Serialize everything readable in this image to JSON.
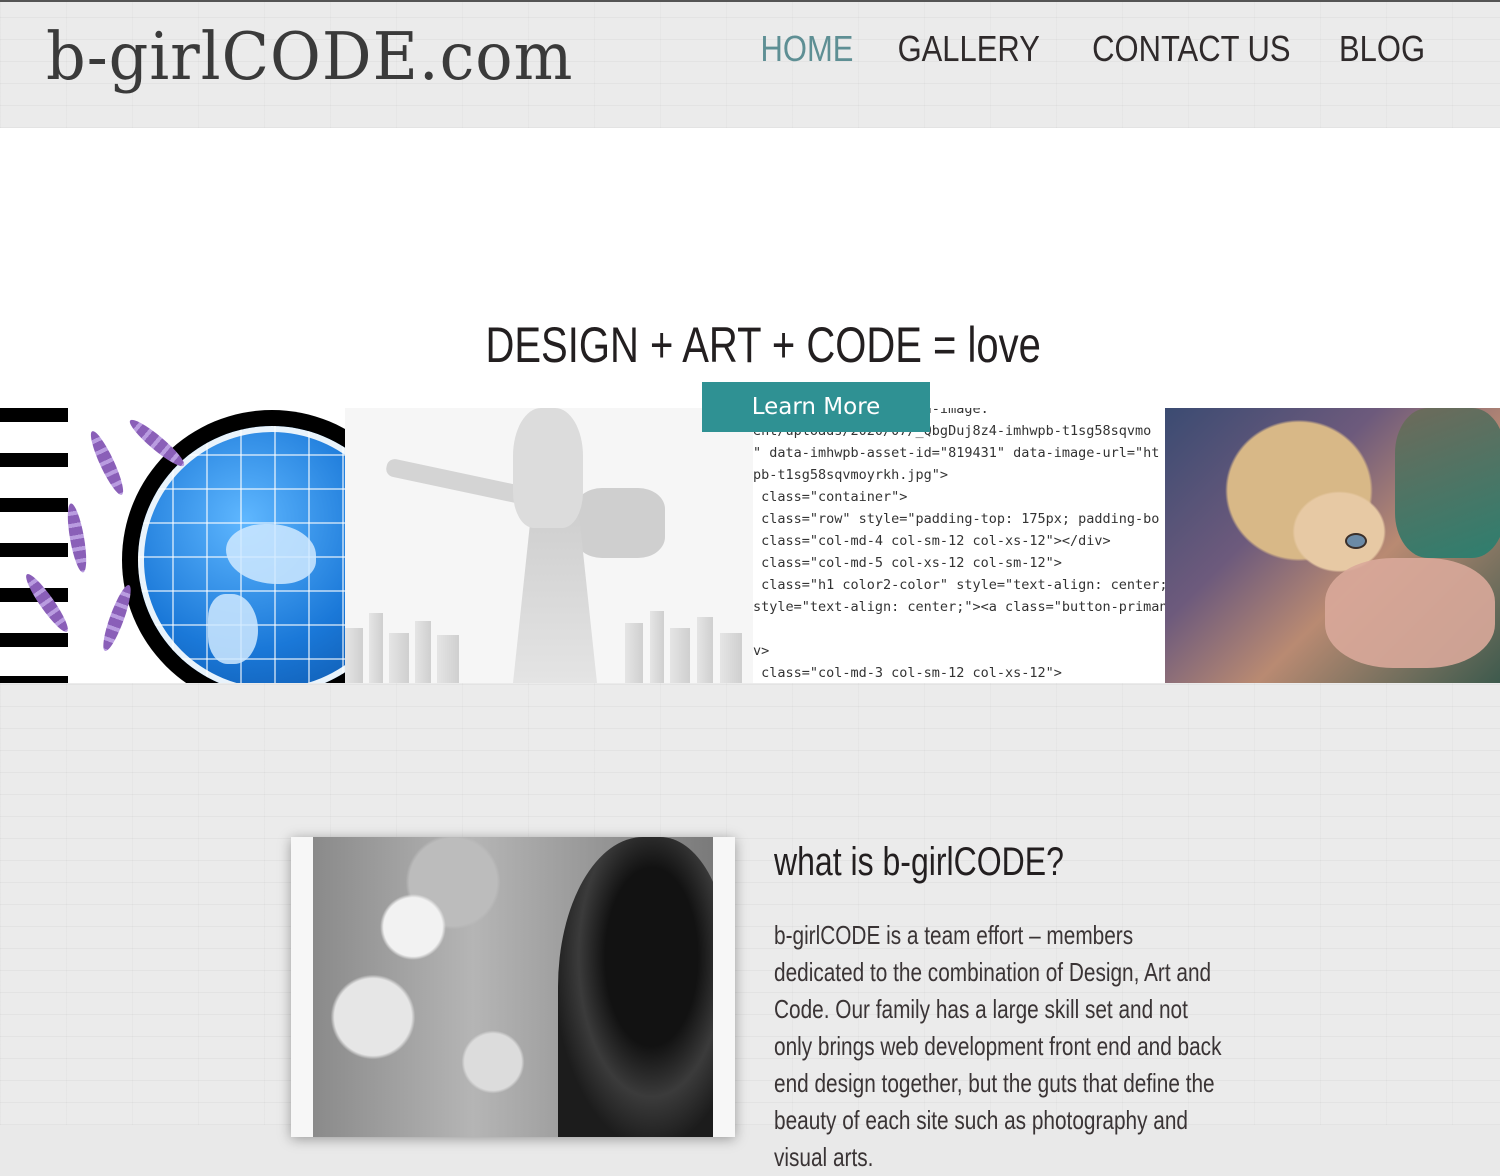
{
  "header": {
    "logo_text": "b-girlCODE.com",
    "nav": [
      {
        "label": "HOME",
        "active": true
      },
      {
        "label": "GALLERY",
        "active": false
      },
      {
        "label": "CONTACT US",
        "active": false
      },
      {
        "label": "BLOG",
        "active": false
      }
    ]
  },
  "hero": {
    "title": "DESIGN + ART + CODE = love",
    "button_label": "Learn More",
    "code_lines": [
      "ion\" style=\"background-image:",
      "ent/uploads/2020/07/_QbgDuj8z4-imhwpb-t1sg58sqvmo",
      "\" data-imhwpb-asset-id=\"819431\" data-image-url=\"ht",
      "pb-t1sg58sqvmoyrkh.jpg\">",
      " class=\"container\">",
      " class=\"row\" style=\"padding-top: 175px; padding-bo",
      " class=\"col-md-4 col-sm-12 col-xs-12\"></div>",
      " class=\"col-md-5 col-xs-12 col-sm-12\">",
      " class=\"h1 color2-color\" style=\"text-align: center;",
      "style=\"text-align: center;\"><a class=\"button-priman",
      "",
      "v>",
      " class=\"col-md-3 col-sm-12 col-xs-12\">"
    ]
  },
  "about": {
    "title": "what is b-girlCODE?",
    "body": "b-girlCODE is a team effort – members dedicated to the combination of Design, Art and Code. Our family has a large skill set and not only brings web development front end and back end design together, but the guts that define the beauty of each site such as photography and visual arts."
  },
  "colors": {
    "accent": "#2f9193",
    "nav_active": "#5e8f94",
    "text": "#231f20"
  }
}
